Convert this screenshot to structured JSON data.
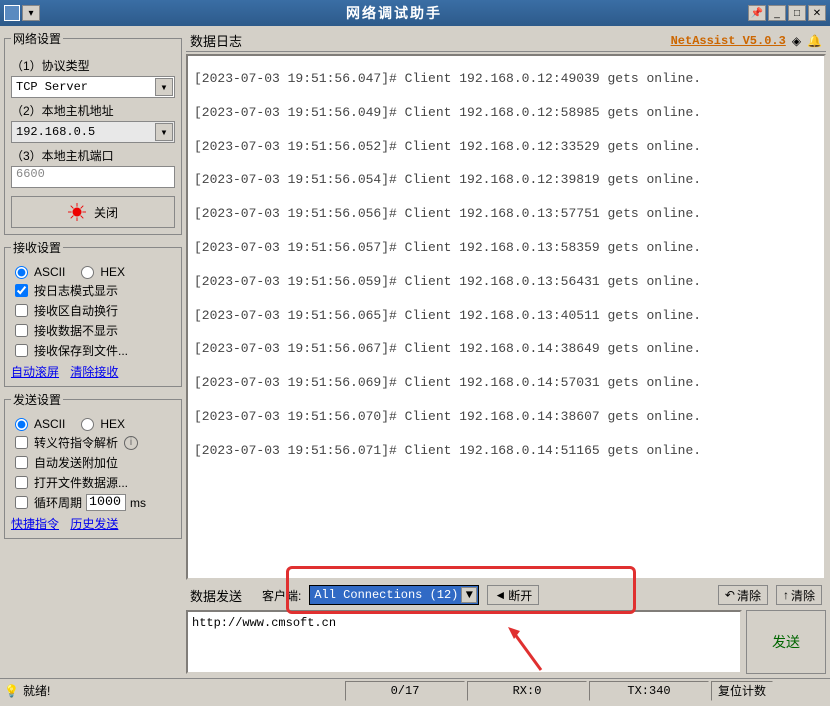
{
  "title": "网络调试助手",
  "version": "NetAssist V5.0.3",
  "network_settings": {
    "legend": "网络设置",
    "protocol_label": "（1）协议类型",
    "protocol_value": "TCP Server",
    "host_label": "（2）本地主机地址",
    "host_value": "192.168.0.5",
    "port_label": "（3）本地主机端口",
    "port_value": "6600",
    "close_btn": "关闭"
  },
  "recv_settings": {
    "legend": "接收设置",
    "ascii": "ASCII",
    "hex": "HEX",
    "log_mode": "按日志模式显示",
    "auto_wrap": "接收区自动换行",
    "hide_recv": "接收数据不显示",
    "save_file": "接收保存到文件...",
    "auto_scroll": "自动滚屏",
    "clear_recv": "清除接收"
  },
  "send_settings": {
    "legend": "发送设置",
    "ascii": "ASCII",
    "hex": "HEX",
    "escape": "转义符指令解析",
    "auto_append": "自动发送附加位",
    "open_file": "打开文件数据源...",
    "cycle": "循环周期",
    "cycle_value": "1000",
    "cycle_unit": "ms",
    "quick_cmd": "快捷指令",
    "history": "历史发送"
  },
  "log": {
    "title": "数据日志",
    "lines": [
      "[2023-07-03 19:51:56.047]# Client 192.168.0.12:49039 gets online.",
      "[2023-07-03 19:51:56.049]# Client 192.168.0.12:58985 gets online.",
      "[2023-07-03 19:51:56.052]# Client 192.168.0.12:33529 gets online.",
      "[2023-07-03 19:51:56.054]# Client 192.168.0.12:39819 gets online.",
      "[2023-07-03 19:51:56.056]# Client 192.168.0.13:57751 gets online.",
      "[2023-07-03 19:51:56.057]# Client 192.168.0.13:58359 gets online.",
      "[2023-07-03 19:51:56.059]# Client 192.168.0.13:56431 gets online.",
      "[2023-07-03 19:51:56.065]# Client 192.168.0.13:40511 gets online.",
      "[2023-07-03 19:51:56.067]# Client 192.168.0.14:38649 gets online.",
      "[2023-07-03 19:51:56.069]# Client 192.168.0.14:57031 gets online.",
      "[2023-07-03 19:51:56.070]# Client 192.168.0.14:38607 gets online.",
      "[2023-07-03 19:51:56.071]# Client 192.168.0.14:51165 gets online."
    ]
  },
  "send": {
    "title": "数据发送",
    "client_label": "客户端:",
    "client_value": "All Connections (12)",
    "disconnect": "断开",
    "clear1": "清除",
    "clear2": "清除",
    "input": "http://www.cmsoft.cn",
    "send_btn": "发送"
  },
  "status": {
    "ready": "就绪!",
    "counter": "0/17",
    "rx": "RX:0",
    "tx": "TX:340",
    "reset": "复位计数"
  }
}
